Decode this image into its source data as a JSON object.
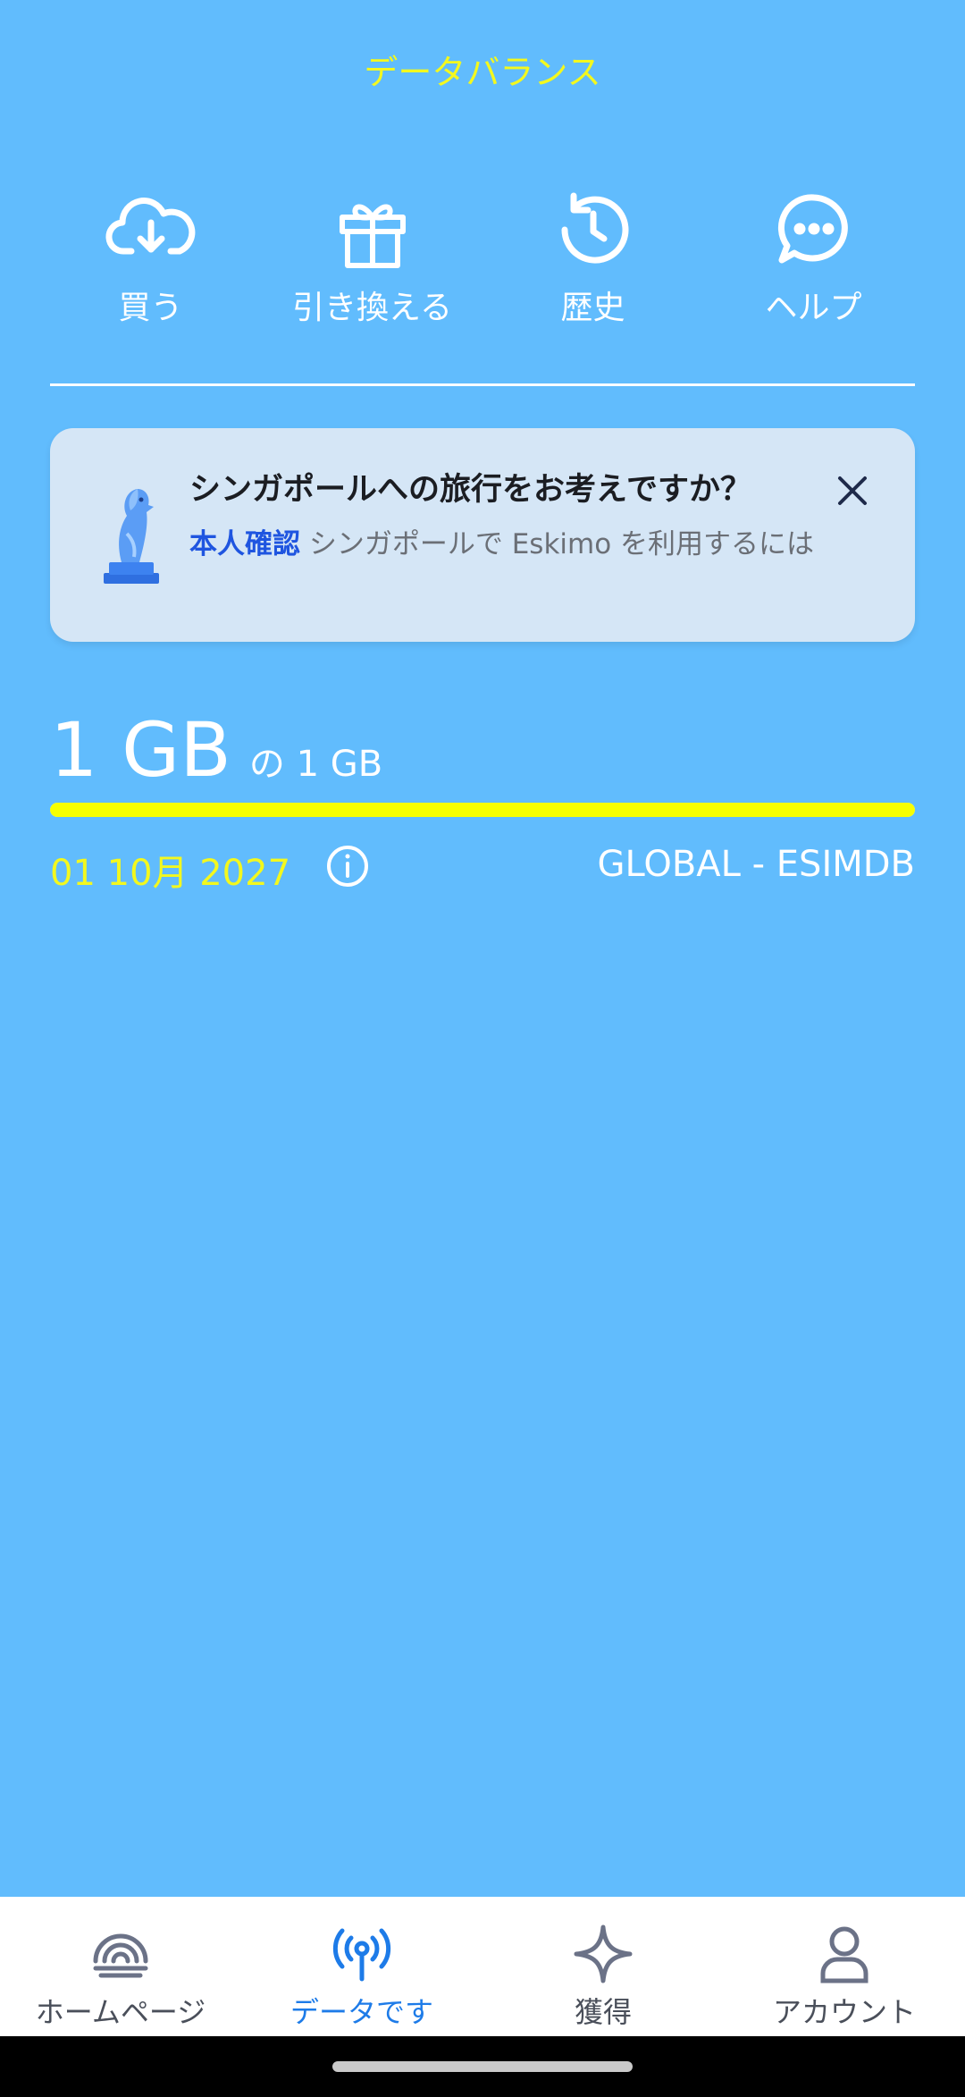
{
  "header": {
    "title": "データバランス"
  },
  "actions": [
    {
      "label": "買う",
      "icon": "cloud-download-icon"
    },
    {
      "label": "引き換える",
      "icon": "gift-icon"
    },
    {
      "label": "歴史",
      "icon": "history-icon"
    },
    {
      "label": "ヘルプ",
      "icon": "chat-icon"
    }
  ],
  "promo": {
    "headline": "シンガポールへの旅行をお考えですか？",
    "link_text": "本人確認",
    "body_text": " シンガポールで Eskimo を利用するには"
  },
  "usage": {
    "remaining": "1 GB",
    "total": "の 1 GB",
    "fraction_remaining": 1.0,
    "expiry": "01 10月 2027",
    "plan": "GLOBAL - ESIMDB"
  },
  "bottom_nav": [
    {
      "label": "ホームページ",
      "icon": "home-rings-icon",
      "active": false
    },
    {
      "label": "データです",
      "icon": "antenna-icon",
      "active": true
    },
    {
      "label": "獲得",
      "icon": "sparkle-icon",
      "active": false
    },
    {
      "label": "アカウント",
      "icon": "person-icon",
      "active": false
    }
  ],
  "colors": {
    "background": "#61bcfd",
    "accent_yellow": "#f3f81e",
    "active_nav": "#1d7be8",
    "link_blue": "#1f55e0"
  }
}
